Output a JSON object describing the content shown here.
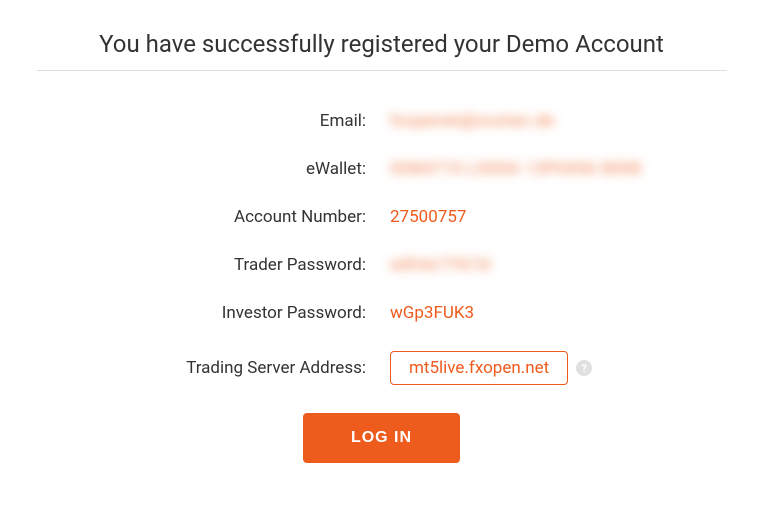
{
  "title": "You have successfully registered your Demo Account",
  "fields": {
    "email": {
      "label": "Email:",
      "value": "fxopenet@xostan.de",
      "redacted": true
    },
    "ewallet": {
      "label": "eWallet:",
      "value": "X08AT10 LX0SA 13P0456 8008",
      "redacted": true
    },
    "account_number": {
      "label": "Account Number:",
      "value": "27500757",
      "redacted": false
    },
    "trader_password": {
      "label": "Trader Password:",
      "value": "w8Ver7Yk7d",
      "redacted": true
    },
    "investor_password": {
      "label": "Investor Password:",
      "value": "wGp3FUK3",
      "redacted": false
    },
    "server_address": {
      "label": "Trading Server Address:",
      "value": "mt5live.fxopen.net",
      "redacted": false
    }
  },
  "help_icon_text": "?",
  "login_button": "LOG IN"
}
